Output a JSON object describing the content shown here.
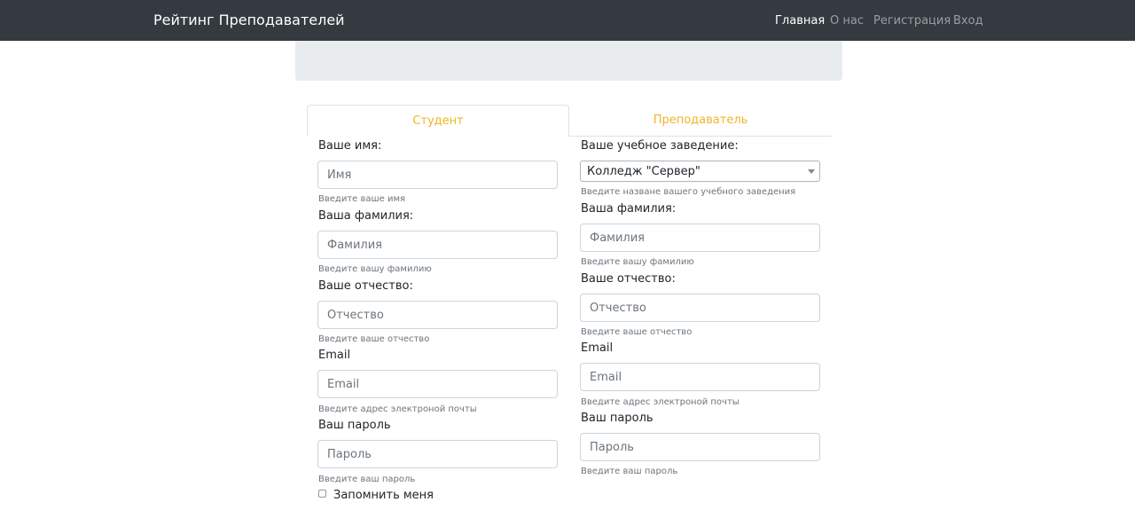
{
  "navbar": {
    "brand": "Рейтинг Преподавателей",
    "links": [
      "Главная",
      "О нас",
      "Регистрация",
      "Вход"
    ]
  },
  "tabs": {
    "student": "Студент",
    "teacher": "Преподаватель"
  },
  "student_form": {
    "name_label": "Ваше имя:",
    "name_placeholder": "Имя",
    "name_hint": "Введите ваше имя",
    "surname_label": "Ваша фамилия:",
    "surname_placeholder": "Фамилия",
    "surname_hint": "Введите вашу фамилию",
    "patronymic_label": "Ваше отчество:",
    "patronymic_placeholder": "Отчество",
    "patronymic_hint": "Введите ваше отчество",
    "email_label": "Email",
    "email_placeholder": "Email",
    "email_hint": "Введите адрес электроной почты",
    "password_label": "Ваш пароль",
    "password_placeholder": "Пароль",
    "password_hint": "Введите ваш пароль",
    "remember_label": "Запомнить меня"
  },
  "teacher_form": {
    "institution_label": "Ваше учебное заведение:",
    "institution_value": "Колледж \"Сервер\"",
    "institution_hint": "Введите назване вашего учебного заведения",
    "surname_label": "Ваша фамилия:",
    "surname_placeholder": "Фамилия",
    "surname_hint": "Введите вашу фамилию",
    "patronymic_label": "Ваше отчество:",
    "patronymic_placeholder": "Отчество",
    "patronymic_hint": "Введите ваше отчество",
    "email_label": "Email",
    "email_placeholder": "Email",
    "email_hint": "Введите адрес электроной почты",
    "password_label": "Ваш пароль",
    "password_placeholder": "Пароль",
    "password_hint": "Введите ваш пароль"
  },
  "colors": {
    "navbar_bg": "#343a40",
    "tab_text": "#f0b528",
    "jumbotron_bg": "#e9ecef"
  }
}
